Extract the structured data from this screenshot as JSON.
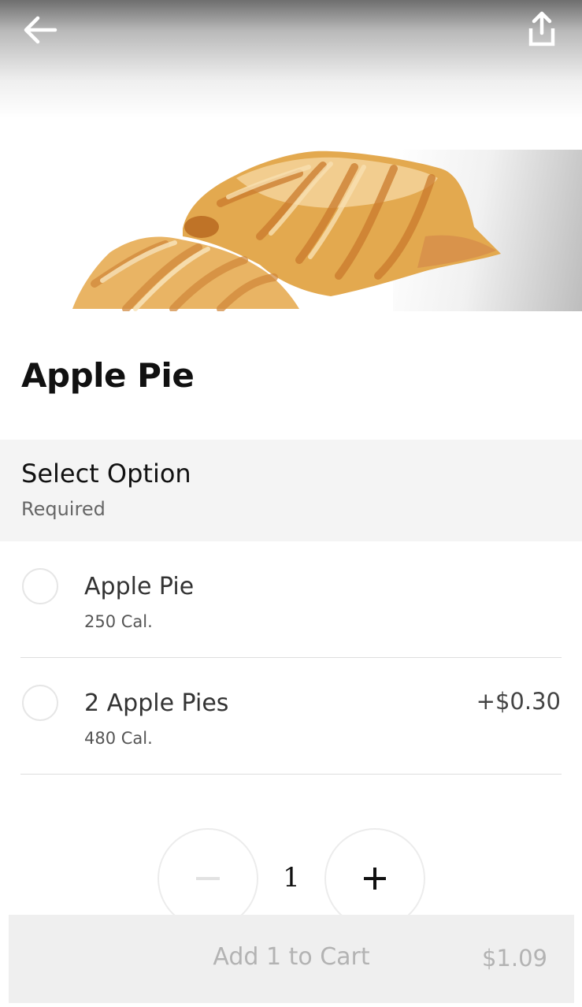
{
  "item": {
    "title": "Apple Pie"
  },
  "options_section": {
    "title": "Select Option",
    "subtitle": "Required",
    "options": [
      {
        "label": "Apple Pie",
        "calories": "250 Cal.",
        "price": "",
        "selected": false
      },
      {
        "label": "2 Apple Pies",
        "calories": "480 Cal.",
        "price": "+$0.30",
        "selected": false
      }
    ]
  },
  "quantity": {
    "value": "1"
  },
  "cart": {
    "label": "Add 1 to Cart",
    "price": "$1.09"
  },
  "icons": {
    "back": "arrow-left-icon",
    "share": "share-icon",
    "minus": "minus-icon",
    "plus": "plus-icon"
  },
  "colors": {
    "section_bg": "#f4f4f4",
    "cart_bg": "#efefef",
    "cart_text": "#b3b3b3",
    "divider": "#dedede"
  }
}
